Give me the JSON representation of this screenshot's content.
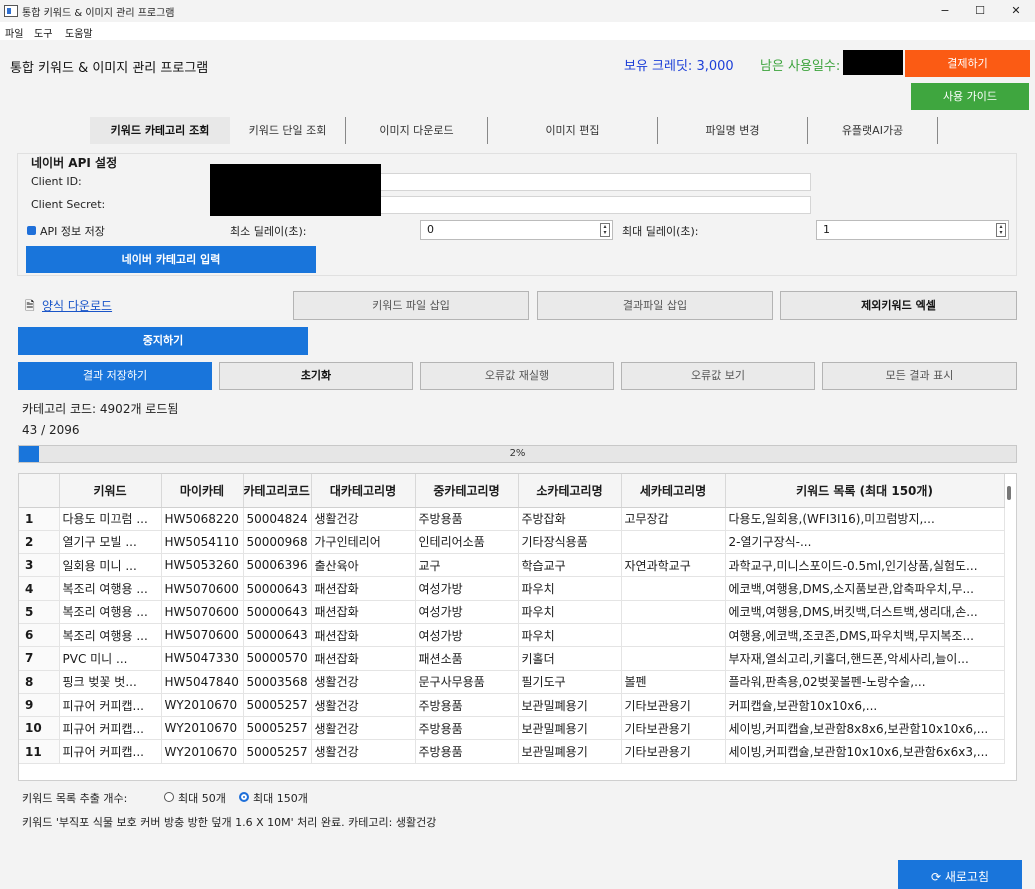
{
  "window": {
    "title": "통합 키워드 & 이미지 관리 프로그램",
    "minimize": "−",
    "maximize": "☐",
    "close": "✕"
  },
  "menu": [
    "파일",
    "도구",
    "도움말"
  ],
  "header": {
    "app_title": "통합 키워드 & 이미지 관리 프로그램",
    "credit_text": "보유 크레딧: 3,000",
    "days_text": "남은 사용일수:",
    "pay_button": "결제하기",
    "guide_button": "사용 가이드"
  },
  "tabs": [
    {
      "label": "키워드 카테고리 조회",
      "active": true
    },
    {
      "label": "키워드 단일 조회",
      "active": false
    },
    {
      "label": "이미지 다운로드",
      "active": false
    },
    {
      "label": "이미지 편집",
      "active": false
    },
    {
      "label": "파일명 변경",
      "active": false
    },
    {
      "label": "유플랫AI가공",
      "active": false
    }
  ],
  "api": {
    "section_title": "네이버 API 설정",
    "client_id_label": "Client ID:",
    "client_secret_label": "Client Secret:",
    "save_label": "API 정보 저장",
    "min_delay_label": "최소 딜레이(초):",
    "min_delay_value": "0",
    "max_delay_label": "최대 딜레이(초):",
    "max_delay_value": "1",
    "category_input_button": "네이버 카테고리 입력"
  },
  "actions": {
    "template_download": "양식 다운로드",
    "keyword_file_insert": "키워드 파일 삽입",
    "result_file_insert": "결과파일 삽입",
    "exclude_keyword_excel": "제외키워드 엑셀",
    "stop": "중지하기",
    "save_results": "결과 저장하기",
    "reset": "초기화",
    "retry_errors": "오류값 재실행",
    "view_errors": "오류값 보기",
    "show_all": "모든 결과 표시"
  },
  "status": {
    "category_loaded": "카테고리 코드: 4902개 로드됨",
    "count": "43 / 2096",
    "progress_percent": 2,
    "progress_label": "2%"
  },
  "table": {
    "headers": [
      "",
      "키워드",
      "마이카테",
      "카테고리코드",
      "대카테고리명",
      "중카테고리명",
      "소카테고리명",
      "세카테고리명",
      "키워드 목록 (최대 150개)"
    ],
    "rows": [
      [
        "1",
        "다용도 미끄럼 ...",
        "HW5068220",
        "50004824",
        "생활건강",
        "주방용품",
        "주방잡화",
        "고무장갑",
        "다용도,일회용,(WFI3I16),미끄럼방지,..."
      ],
      [
        "2",
        "열기구 모빌 ...",
        "HW5054110",
        "50000968",
        "가구인테리어",
        "인테리어소품",
        "기타장식용품",
        "",
        "2-열기구장식-..."
      ],
      [
        "3",
        "일회용 미니 ...",
        "HW5053260",
        "50006396",
        "출산육아",
        "교구",
        "학습교구",
        "자연과학교구",
        "과학교구,미니스포이드-0.5ml,인기상품,실험도..."
      ],
      [
        "4",
        "복조리 여행용 ...",
        "HW5070600",
        "50000643",
        "패션잡화",
        "여성가방",
        "파우치",
        "",
        "에코백,여행용,DMS,소지품보관,압축파우치,무..."
      ],
      [
        "5",
        "복조리 여행용 ...",
        "HW5070600",
        "50000643",
        "패션잡화",
        "여성가방",
        "파우치",
        "",
        "에코백,여행용,DMS,버킷백,더스트백,생리대,손..."
      ],
      [
        "6",
        "복조리 여행용 ...",
        "HW5070600",
        "50000643",
        "패션잡화",
        "여성가방",
        "파우치",
        "",
        "여행용,에코백,조코존,DMS,파우치백,무지복조..."
      ],
      [
        "7",
        "PVC 미니 ...",
        "HW5047330",
        "50000570",
        "패션잡화",
        "패션소품",
        "키홀더",
        "",
        "부자재,열쇠고리,키홀더,핸드폰,악세사리,늘이..."
      ],
      [
        "8",
        "핑크 벚꽃 벗...",
        "HW5047840",
        "50003568",
        "생활건강",
        "문구사무용품",
        "필기도구",
        "볼펜",
        "플라워,판촉용,02벚꽃볼펜-노랑수술,..."
      ],
      [
        "9",
        "피규어 커피캡...",
        "WY2010670",
        "50005257",
        "생활건강",
        "주방용품",
        "보관밀폐용기",
        "기타보관용기",
        "커피캡슐,보관함10x10x6,..."
      ],
      [
        "10",
        "피규어 커피캡...",
        "WY2010670",
        "50005257",
        "생활건강",
        "주방용품",
        "보관밀폐용기",
        "기타보관용기",
        "세이빙,커피캡슐,보관함8x8x6,보관함10x10x6,..."
      ],
      [
        "11",
        "피규어 커피캡...",
        "WY2010670",
        "50005257",
        "생활건강",
        "주방용품",
        "보관밀폐용기",
        "기타보관용기",
        "세이빙,커피캡슐,보관함10x10x6,보관함6x6x3,..."
      ]
    ]
  },
  "footer": {
    "extract_label": "키워드 목록 추출 개수:",
    "option_50": "최대 50개",
    "option_150": "최대 150개",
    "selected_option": "최대 150개",
    "log": "키워드 '부직포 식물 보호 커버 방충 방한 덮개 1.6 X 10M' 처리 완료. 카테고리: 생활건강",
    "refresh_button": "새로고침"
  },
  "colors": {
    "accent_blue": "#1975db",
    "pay_orange": "#fb5b14",
    "guide_green": "#3fa63f",
    "credit_blue": "#1c3fd8",
    "days_green": "#3ea43e"
  }
}
